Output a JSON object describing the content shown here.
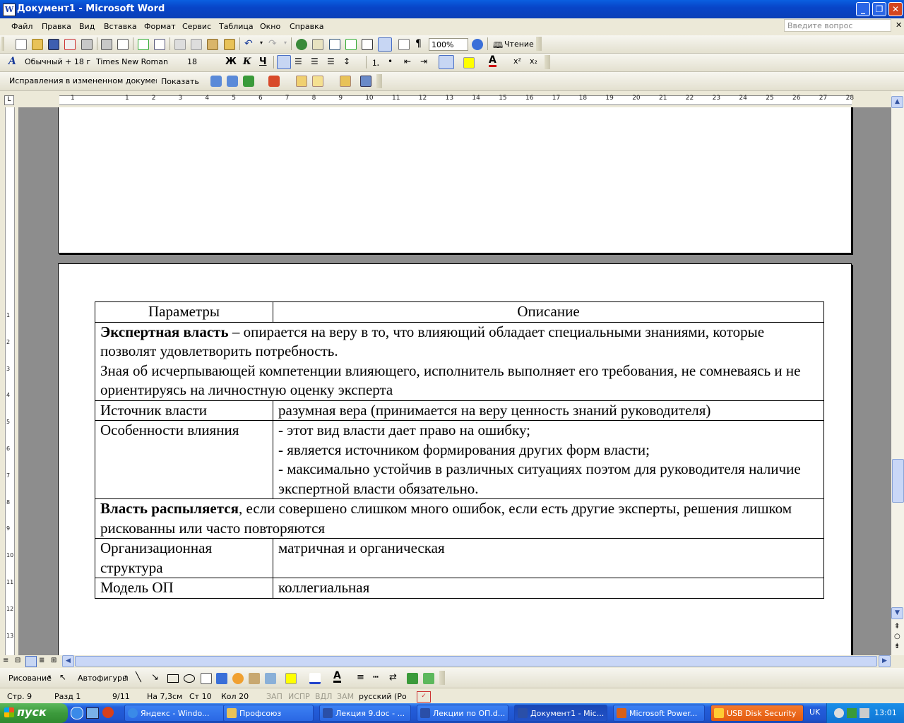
{
  "window": {
    "title": "Документ1 - Microsoft Word",
    "icon_letter": "W"
  },
  "menu": {
    "items": [
      "Файл",
      "Правка",
      "Вид",
      "Вставка",
      "Формат",
      "Сервис",
      "Таблица",
      "Окно",
      "Справка"
    ],
    "ask_placeholder": "Введите вопрос"
  },
  "toolbar_standard": {
    "zoom": "100%",
    "reading_label": "Чтение"
  },
  "toolbar_formatting": {
    "style": "Обычный + 18 г",
    "font": "Times New Roman",
    "size": "18",
    "bold": "Ж",
    "italic": "К",
    "underline": "Ч",
    "font_color_label": "A"
  },
  "toolbar_review": {
    "mode": "Исправления в измененном документе",
    "show_label": "Показать"
  },
  "ruler": {
    "h_numbers": [
      "1",
      "1",
      "2",
      "3",
      "4",
      "5",
      "6",
      "7",
      "8",
      "9",
      "10",
      "11",
      "12",
      "13",
      "14",
      "15",
      "16",
      "17",
      "18",
      "19",
      "20",
      "21",
      "22",
      "23",
      "24",
      "25",
      "26",
      "27",
      "28"
    ],
    "v_numbers": [
      "1",
      "2",
      "3",
      "4",
      "5",
      "6",
      "7",
      "8",
      "9",
      "10",
      "11",
      "12",
      "13"
    ]
  },
  "table": {
    "header": {
      "col1": "Параметры",
      "col2": "Описание"
    },
    "expert": {
      "bold": "Экспертная власть",
      "rest": " – опирается на веру в то, что влияющий обладает специальными знаниями, которые позволят удовлетворить потребность.",
      "line2": "Зная об исчерпывающей компетенции влияющего, исполнитель выполняет его требования, не сомневаясь и не ориентируясь на личностную оценку эксперта"
    },
    "source": {
      "label": "Источник власти",
      "value": "разумная вера (принимается на веру ценность знаний руководителя)"
    },
    "features": {
      "label": "Особенности влияния",
      "items": [
        "- этот вид власти дает право на ошибку;",
        "- является источником формирования других форм власти;",
        "- максимально устойчив в различных ситуациях поэтом для руководителя наличие экспертной власти обязательно."
      ]
    },
    "dispersal": {
      "bold": "Власть распыляется",
      "rest": ", если совершено слишком много ошибок, если есть другие эксперты, решения лишком рискованны или часто повторяются"
    },
    "structure": {
      "label": "Организационная структура",
      "value": "матричная и органическая"
    },
    "model": {
      "label": "Модель ОП",
      "value": "коллегиальная"
    }
  },
  "drawing_toolbar": {
    "draw_label": "Рисование",
    "autoshapes_label": "Автофигуры"
  },
  "status": {
    "page": "Стр. 9",
    "section": "Разд 1",
    "pages": "9/11",
    "at": "На 7,3см",
    "line": "Ст 10",
    "col": "Кол 20",
    "rec": "ЗАП",
    "trk": "ИСПР",
    "ext": "ВДЛ",
    "ovr": "ЗАМ",
    "lang": "русский (Ро"
  },
  "taskbar": {
    "start_label": "пуск",
    "tasks": [
      "Яндекс - Windo...",
      "Профсоюз",
      "Лекция 9.doc - ...",
      "Лекции по ОП.d...",
      "Документ1 - Mic...",
      "Microsoft Power...",
      "USB Disk Security"
    ],
    "lang": "UK",
    "clock": "13:01"
  },
  "colors": {
    "titlebar": "#0a5fe0",
    "taskbar": "#245edb",
    "start": "#3c9a3c",
    "page": "#ffffff",
    "workspace": "#8d8d8d"
  }
}
